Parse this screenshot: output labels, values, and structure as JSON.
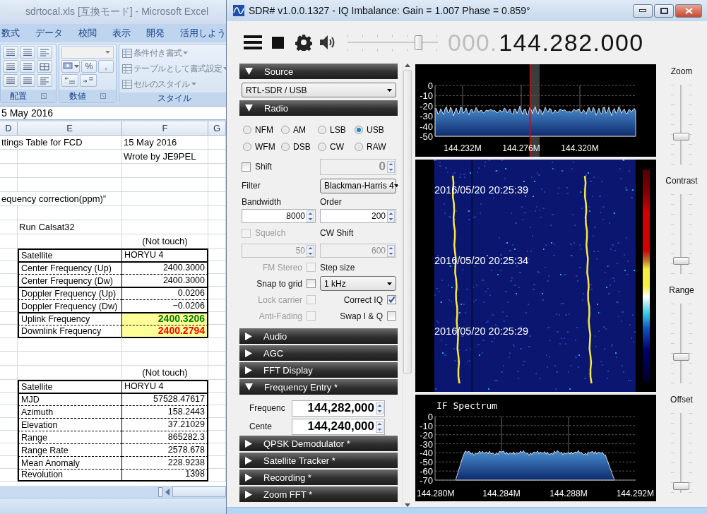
{
  "excel": {
    "title": "sdrtocal.xls [互換モード] - Microsoft Excel",
    "tabs": [
      "数式",
      "データ",
      "校閲",
      "表示",
      "開発",
      "活用しよう"
    ],
    "ribbon": {
      "alignment_group": "配置",
      "number_group": {
        "title": "数値",
        "percent": "%",
        "comma": ","
      },
      "style_group": {
        "title": "スタイル",
        "items": [
          "条件付き書式",
          "テーブルとして書式設定",
          "セルのスタイル"
        ]
      }
    },
    "formula_bar": "5 May 2016",
    "columns": [
      "D",
      "E",
      "F",
      "G"
    ],
    "rows": [
      {
        "kind": "text",
        "d": "ttings Table for FCD",
        "f": "15 May 2016"
      },
      {
        "kind": "text",
        "f": "Wrote by JE9PEL"
      },
      {
        "kind": "blank"
      },
      {
        "kind": "blank"
      },
      {
        "kind": "text",
        "d": "equency correction(ppm)”"
      },
      {
        "kind": "blank"
      },
      {
        "kind": "text",
        "e": "Run Calsat32"
      },
      {
        "kind": "note",
        "f": "(Not touch)"
      },
      {
        "kind": "table",
        "groups": [
          [
            {
              "label": "Satellite",
              "value": "HORYU 4",
              "highlighted": false
            }
          ],
          [
            {
              "label": "Center Frequency (Up)",
              "value": "2400.3000",
              "highlighted": false
            },
            {
              "label": "Center Frequency (Dw)",
              "value": "2400.3000",
              "highlighted": false
            }
          ],
          [
            {
              "label": "Doppler Frequency (Up)",
              "value": "0.0206",
              "highlighted": false
            },
            {
              "label": "Doppler Frequency (Dw)",
              "value": "−0.0206",
              "highlighted": false
            }
          ],
          [
            {
              "label": "Uplink Frequency",
              "value": "2400.3206",
              "highlighted": true,
              "color": "#008000"
            },
            {
              "label": "Downlink Frequency",
              "value": "2400.2794",
              "highlighted": true,
              "color": "#ff0000"
            }
          ]
        ]
      },
      {
        "kind": "blank"
      },
      {
        "kind": "blank"
      },
      {
        "kind": "note",
        "f": "(Not touch)"
      },
      {
        "kind": "table",
        "groups": [
          [
            {
              "label": "Satellite",
              "value": "HORYU 4",
              "highlighted": false
            }
          ],
          [
            {
              "label": "MJD",
              "value": "57528.47617",
              "highlighted": false
            },
            {
              "label": "Azimuth",
              "value": "158.2443",
              "highlighted": false
            },
            {
              "label": "Elevation",
              "value": "37.21029",
              "highlighted": false
            },
            {
              "label": "Range",
              "value": "865282.3",
              "highlighted": false
            },
            {
              "label": "Range Rate",
              "value": "2578.678",
              "highlighted": false
            },
            {
              "label": "Mean Anomaly",
              "value": "228.9238",
              "highlighted": false
            },
            {
              "label": "Revolution",
              "value": "1398",
              "highlighted": false
            }
          ]
        ]
      }
    ]
  },
  "sdr": {
    "title": "SDR# v1.0.0.1327 - IQ Imbalance: Gain = 1.007 Phase = 0.859°",
    "volume": {
      "level": 0.78
    },
    "frequency": {
      "prefix": "000.",
      "value": "144.282.000"
    },
    "sections": [
      {
        "kind": "source",
        "title": "Source",
        "expanded": true,
        "device": "RTL-SDR / USB"
      },
      {
        "kind": "radio",
        "title": "Radio",
        "expanded": true,
        "modes": [
          {
            "label": "NFM",
            "selected": false
          },
          {
            "label": "AM",
            "selected": false
          },
          {
            "label": "LSB",
            "selected": false
          },
          {
            "label": "USB",
            "selected": true
          },
          {
            "label": "WFM",
            "selected": false
          },
          {
            "label": "DSB",
            "selected": false
          },
          {
            "label": "CW",
            "selected": false
          },
          {
            "label": "RAW",
            "selected": false
          }
        ],
        "shift": {
          "label": "Shift",
          "checked": false,
          "value": "0"
        },
        "filter": {
          "label": "Filter",
          "value": "Blackman-Harris 4"
        },
        "bandwidth": {
          "label": "Bandwidth",
          "value": "8000"
        },
        "order": {
          "label": "Order",
          "value": "200"
        },
        "squelch": {
          "label": "Squelch",
          "checked": false,
          "disabled": true,
          "value": "50"
        },
        "cw_shift": {
          "label": "CW Shift",
          "value": "600",
          "disabled": true
        },
        "left_options": [
          {
            "label": "FM Stereo",
            "checked": false,
            "disabled": true
          },
          {
            "label": "Snap to grid",
            "checked": false,
            "disabled": false
          },
          {
            "label": "Lock carrier",
            "checked": false,
            "disabled": true
          },
          {
            "label": "Anti-Fading",
            "checked": false,
            "disabled": true
          }
        ],
        "step_size": {
          "label": "Step size",
          "value": "1 kHz"
        },
        "right_options": [
          {
            "label": "Correct IQ",
            "checked": true
          },
          {
            "label": "Swap I & Q",
            "checked": false
          }
        ]
      },
      {
        "kind": "header",
        "title": "Audio",
        "expanded": false
      },
      {
        "kind": "header",
        "title": "AGC",
        "expanded": false
      },
      {
        "kind": "header",
        "title": "FFT Display",
        "expanded": false
      },
      {
        "kind": "frequency_entry",
        "title": "Frequency Entry *",
        "expanded": true,
        "fields": [
          {
            "label": "Frequenc",
            "value": "144,282,000"
          },
          {
            "label": "Cente",
            "value": "144,240,000"
          }
        ]
      },
      {
        "kind": "header",
        "title": "QPSK Demodulator *",
        "expanded": false
      },
      {
        "kind": "header",
        "title": "Satellite Tracker *",
        "expanded": false
      },
      {
        "kind": "header",
        "title": "Recording *",
        "expanded": false
      },
      {
        "kind": "header",
        "title": "Zoom FFT *",
        "expanded": false
      }
    ],
    "spectrum": {
      "y_labels": [
        "0",
        "-10",
        "-20",
        "-30",
        "-40",
        "-50"
      ],
      "x_labels": [
        "144.232M",
        "144.276M",
        "144.320M"
      ]
    },
    "waterfall": {
      "timestamps": [
        "2016/05/20 20:25:39",
        "2016/05/20 20:25:34",
        "2016/05/20 20:25:29"
      ]
    },
    "if_spectrum": {
      "title": "IF Spectrum",
      "y_labels": [
        "0",
        "-10",
        "-20",
        "-30",
        "-40",
        "-50",
        "-60",
        "-70"
      ],
      "x_labels": [
        "144.280M",
        "144.284M",
        "144.288M",
        "144.292M"
      ]
    },
    "sliders": [
      {
        "label": "Zoom",
        "level": 0.33
      },
      {
        "label": "Contrast",
        "level": 0.13
      },
      {
        "label": "Range",
        "level": 0.31
      },
      {
        "label": "Offset",
        "level": 0.04
      }
    ]
  }
}
